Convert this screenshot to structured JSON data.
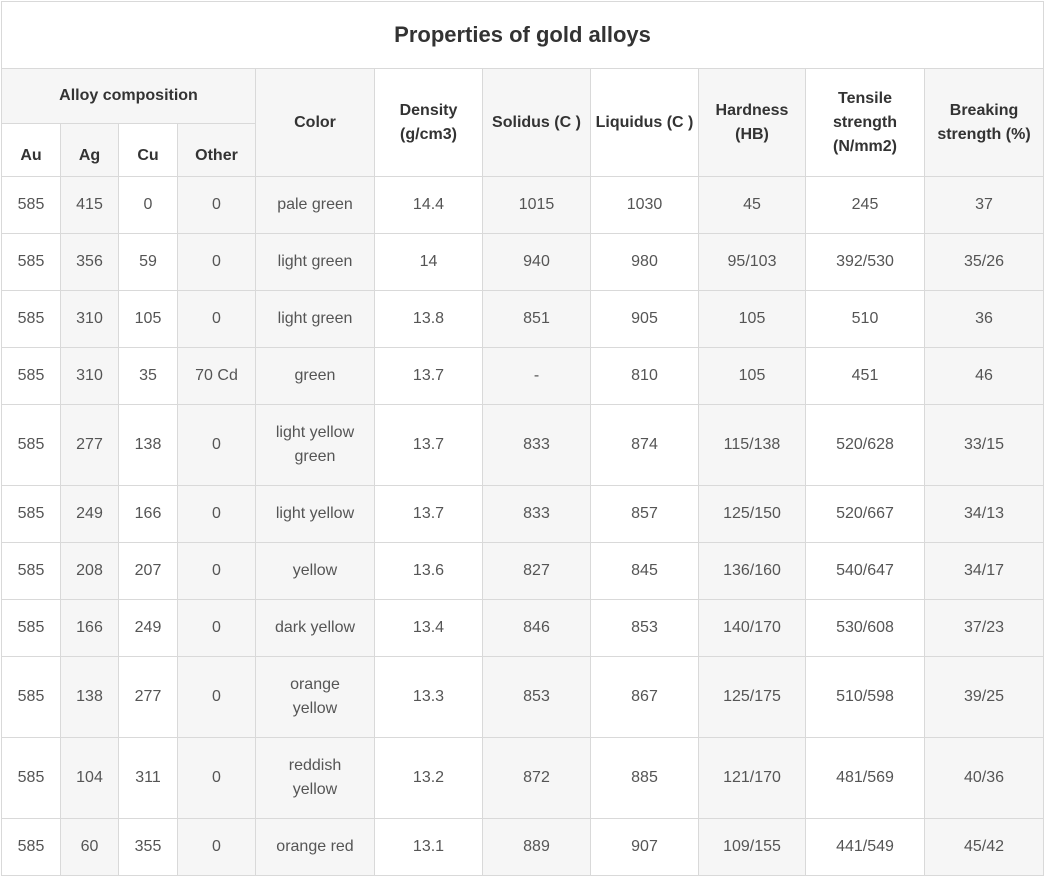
{
  "table": {
    "title": "Properties of gold alloys",
    "group_header": "Alloy composition",
    "sub_headers": [
      "Au",
      "Ag",
      "Cu",
      "Other"
    ],
    "headers": {
      "color": "Color",
      "density": "Density (g/cm3)",
      "solidus": "Solidus (C )",
      "liquidus": "Liquidus (C )",
      "hardness": "Hardness (HB)",
      "tensile": "Tensile strength (N/mm2)",
      "breaking": "Breaking strength (%)"
    },
    "rows": [
      [
        "585",
        "415",
        "0",
        "0",
        "pale green",
        "14.4",
        "1015",
        "1030",
        "45",
        "245",
        "37"
      ],
      [
        "585",
        "356",
        "59",
        "0",
        "light green",
        "14",
        "940",
        "980",
        "95/103",
        "392/530",
        "35/26"
      ],
      [
        "585",
        "310",
        "105",
        "0",
        "light green",
        "13.8",
        "851",
        "905",
        "105",
        "510",
        "36"
      ],
      [
        "585",
        "310",
        "35",
        "70 Cd",
        "green",
        "13.7",
        "-",
        "810",
        "105",
        "451",
        "46"
      ],
      [
        "585",
        "277",
        "138",
        "0",
        "light yellow green",
        "13.7",
        "833",
        "874",
        "115/138",
        "520/628",
        "33/15"
      ],
      [
        "585",
        "249",
        "166",
        "0",
        "light yellow",
        "13.7",
        "833",
        "857",
        "125/150",
        "520/667",
        "34/13"
      ],
      [
        "585",
        "208",
        "207",
        "0",
        "yellow",
        "13.6",
        "827",
        "845",
        "136/160",
        "540/647",
        "34/17"
      ],
      [
        "585",
        "166",
        "249",
        "0",
        "dark yellow",
        "13.4",
        "846",
        "853",
        "140/170",
        "530/608",
        "37/23"
      ],
      [
        "585",
        "138",
        "277",
        "0",
        "orange yellow",
        "13.3",
        "853",
        "867",
        "125/175",
        "510/598",
        "39/25"
      ],
      [
        "585",
        "104",
        "311",
        "0",
        "reddish yellow",
        "13.2",
        "872",
        "885",
        "121/170",
        "481/569",
        "40/36"
      ],
      [
        "585",
        "60",
        "355",
        "0",
        "orange red",
        "13.1",
        "889",
        "907",
        "109/155",
        "441/549",
        "45/42"
      ]
    ]
  }
}
